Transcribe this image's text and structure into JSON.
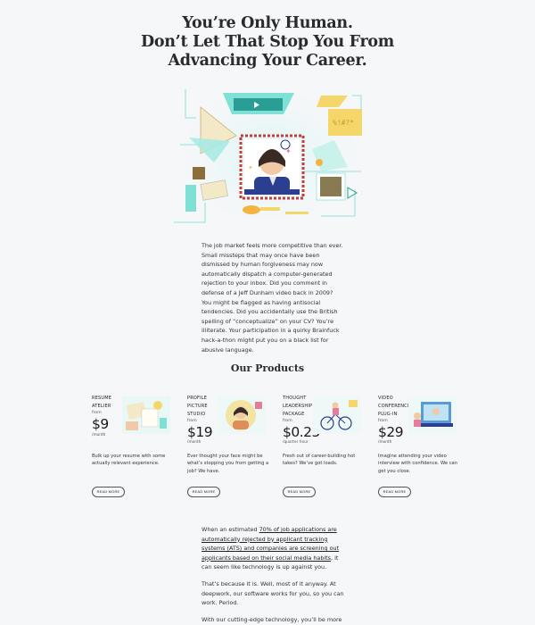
{
  "hero": {
    "title_line1": "You’re Only Human.",
    "title_line2": "Don’t Let That Stop You From",
    "title_line3": "Advancing Your Career."
  },
  "intro": {
    "text": "The job market feels more competitive than ever. Small missteps that may once have been dismissed by human forgiveness may now automatically dispatch a computer-generated rejection to your inbox. Did you comment in defense of a Jeff Dunham video back in 2009? You might be flagged as having antisocial tendencies. Did you accidentally use the British spelling of “conceptualize” on your CV? You’re illiterate. Your participation in a quirky Brainfuck hack-a-thon might put you on a black list for abusive language."
  },
  "products": {
    "heading": "Our Products",
    "items": [
      {
        "name_lines": [
          "RESUME",
          "ATELIER"
        ],
        "from": "from",
        "price": "$9",
        "period": "/month",
        "desc": "Bulk up your resume with some actually relevant experience.",
        "button": "READ MORE",
        "icon": "resume-illustration-icon"
      },
      {
        "name_lines": [
          "PROFILE",
          "PICTURE",
          "STUDIO"
        ],
        "from": "from",
        "price": "$19",
        "period": "/month",
        "desc": "Ever thought your face might be what’s stopping you from getting a job? We have.",
        "button": "READ MORE",
        "icon": "portrait-illustration-icon"
      },
      {
        "name_lines": [
          "THOUGHT",
          "LEADERSHIP",
          "PACKAGE"
        ],
        "from": "from",
        "price": "$0.25",
        "period": "/quarter hour",
        "desc": "Fresh out of career-building hot takes? We’ve got loads.",
        "button": "READ MORE",
        "icon": "cyclist-illustration-icon"
      },
      {
        "name_lines": [
          "VIDEO",
          "CONFERENCING",
          "PLUG-IN"
        ],
        "from": "from",
        "price": "$29",
        "period": "/month",
        "desc": "Imagine attending your video interview with confidence. We can get you close.",
        "button": "READ MORE",
        "icon": "video-call-illustration-icon"
      }
    ]
  },
  "body": {
    "p1_a": "When an estimated ",
    "p1_link": "70% of job applications are automatically rejected by applicant tracking systems (ATS) and companies are screening out applicants based on their social media habits",
    "p1_b": ", it can seem like technology is up against you.",
    "p2": "That’s because it is. Well, most of it anyway. At deepwork, our software works for you, so you can work. Period.",
    "p3": "With our cutting-edge technology, you’ll be more than just another statistic. We are able to"
  },
  "colors": {
    "background": "#f6f7f9",
    "accent_cyan": "#6fdcd4",
    "accent_yellow": "#f5d66a",
    "text": "#2a2a2a"
  }
}
